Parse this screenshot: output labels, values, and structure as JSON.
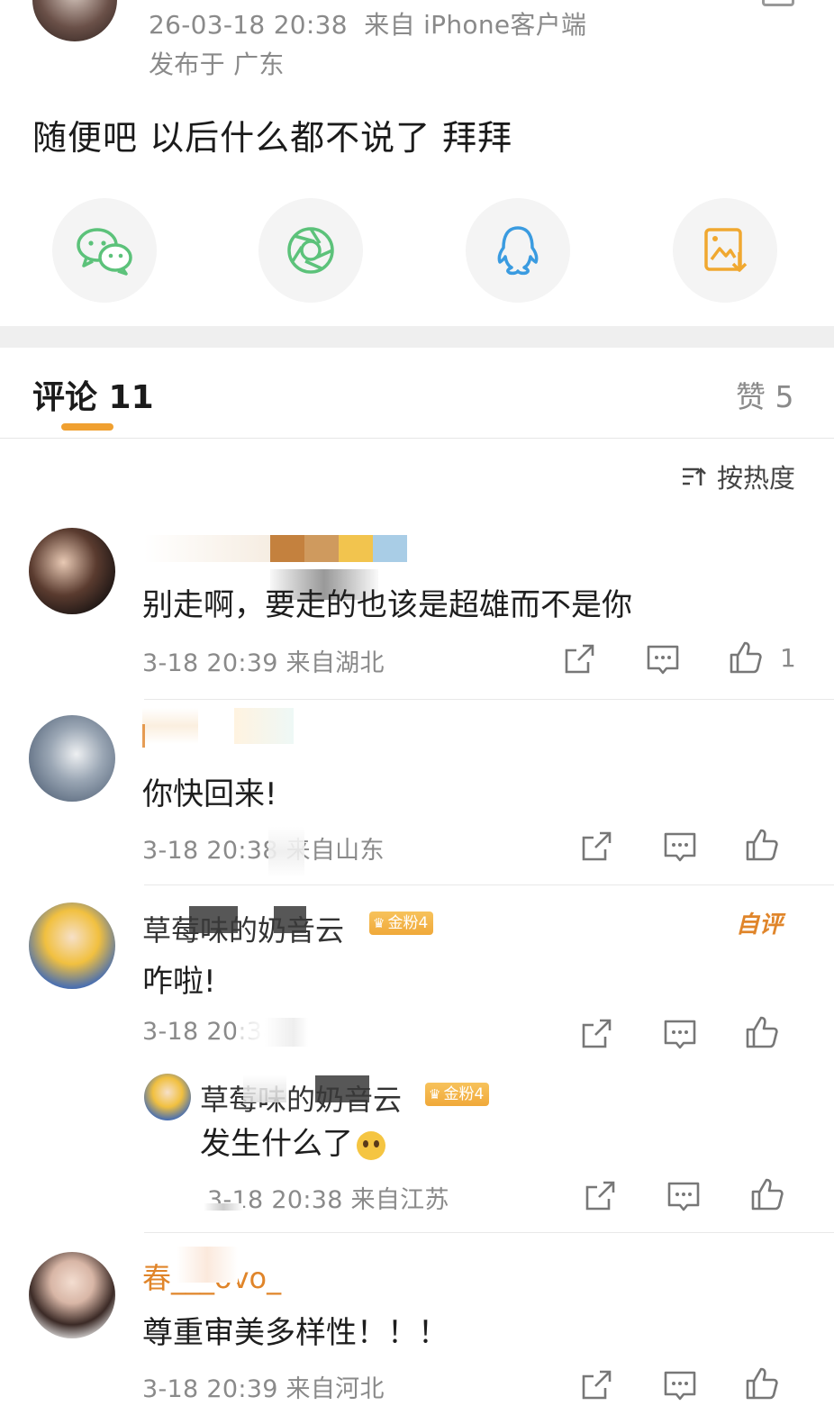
{
  "post": {
    "timestamp": "26-03-18 20:38",
    "source": "来自 iPhone客户端",
    "location": "发布于 广东",
    "text": "随便吧 以后什么都不说了 拜拜"
  },
  "share_icons": [
    "wechat-icon",
    "moments-icon",
    "qq-icon",
    "save-image-icon"
  ],
  "tabs": {
    "comments_label": "评论 11",
    "likes_label": "赞 5"
  },
  "sort": {
    "label": "按热度"
  },
  "comments": [
    {
      "name": "",
      "text": "别走啊，要走的也该是超雄而不是你",
      "meta": "3-18 20:39 来自湖北",
      "likes": "1"
    },
    {
      "name": "",
      "text": "你快回来!",
      "meta": "3-18 20:38 来自山东",
      "likes": ""
    },
    {
      "name": "草莓味的奶音云",
      "badge": "金粉4",
      "author_tag": "自评",
      "text": "咋啦!",
      "meta": "3-18 20:38",
      "likes": "",
      "reply": {
        "name": "草莓味的奶音云",
        "badge": "金粉4",
        "text": "发生什么了",
        "meta": "3-18 20:38 来自江苏"
      }
    },
    {
      "name": "春___ovo_",
      "text": "尊重审美多样性！！！",
      "meta": "3-18 20:39 来自河北",
      "likes": ""
    }
  ],
  "colors": {
    "accent": "#e0852a",
    "tab_indicator": "#f0a030"
  }
}
